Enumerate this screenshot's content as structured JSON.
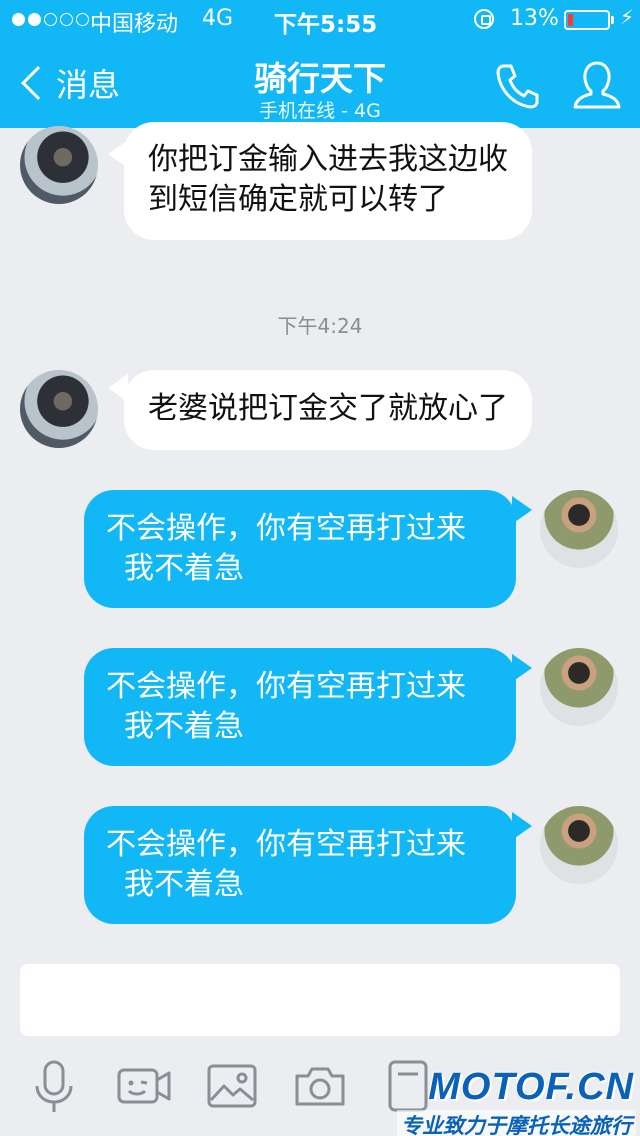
{
  "status_bar": {
    "carrier": "中国移动",
    "network": "4G",
    "time": "下午5:55",
    "battery_percent_text": "13%",
    "battery_level": 0.13,
    "signal_bars_filled": 2,
    "signal_bars_total": 5
  },
  "header": {
    "back_label": "消息",
    "title": "骑行天下",
    "subtitle": "手机在线 - 4G",
    "phone_icon": "phone-icon",
    "profile_icon": "profile-icon"
  },
  "messages": [
    {
      "direction": "incoming",
      "text_lines": [
        "你把订金输入进去我这边收",
        "到短信确定就可以转了"
      ]
    },
    {
      "direction": "incoming",
      "text_lines": [
        "老婆说把订金交了就放心了"
      ]
    },
    {
      "direction": "outgoing",
      "text_lines": [
        "不会操作，你有空再打过来",
        "我不着急"
      ]
    },
    {
      "direction": "outgoing",
      "text_lines": [
        "不会操作，你有空再打过来",
        "我不着急"
      ]
    },
    {
      "direction": "outgoing",
      "text_lines": [
        "不会操作，你有空再打过来",
        "我不着急"
      ]
    }
  ],
  "timestamp": "下午4:24",
  "toolbar": {
    "icons": [
      "microphone-icon",
      "video-icon",
      "image-icon",
      "camera-icon",
      "file-icon"
    ]
  },
  "watermark": {
    "logo": "MOTOF.CN",
    "tagline": "专业致力于摩托长途旅行"
  },
  "colors": {
    "accent": "#12b7f5",
    "background": "#ebedf0",
    "incoming_bubble": "#ffffff",
    "outgoing_bubble": "#12b7f5"
  }
}
